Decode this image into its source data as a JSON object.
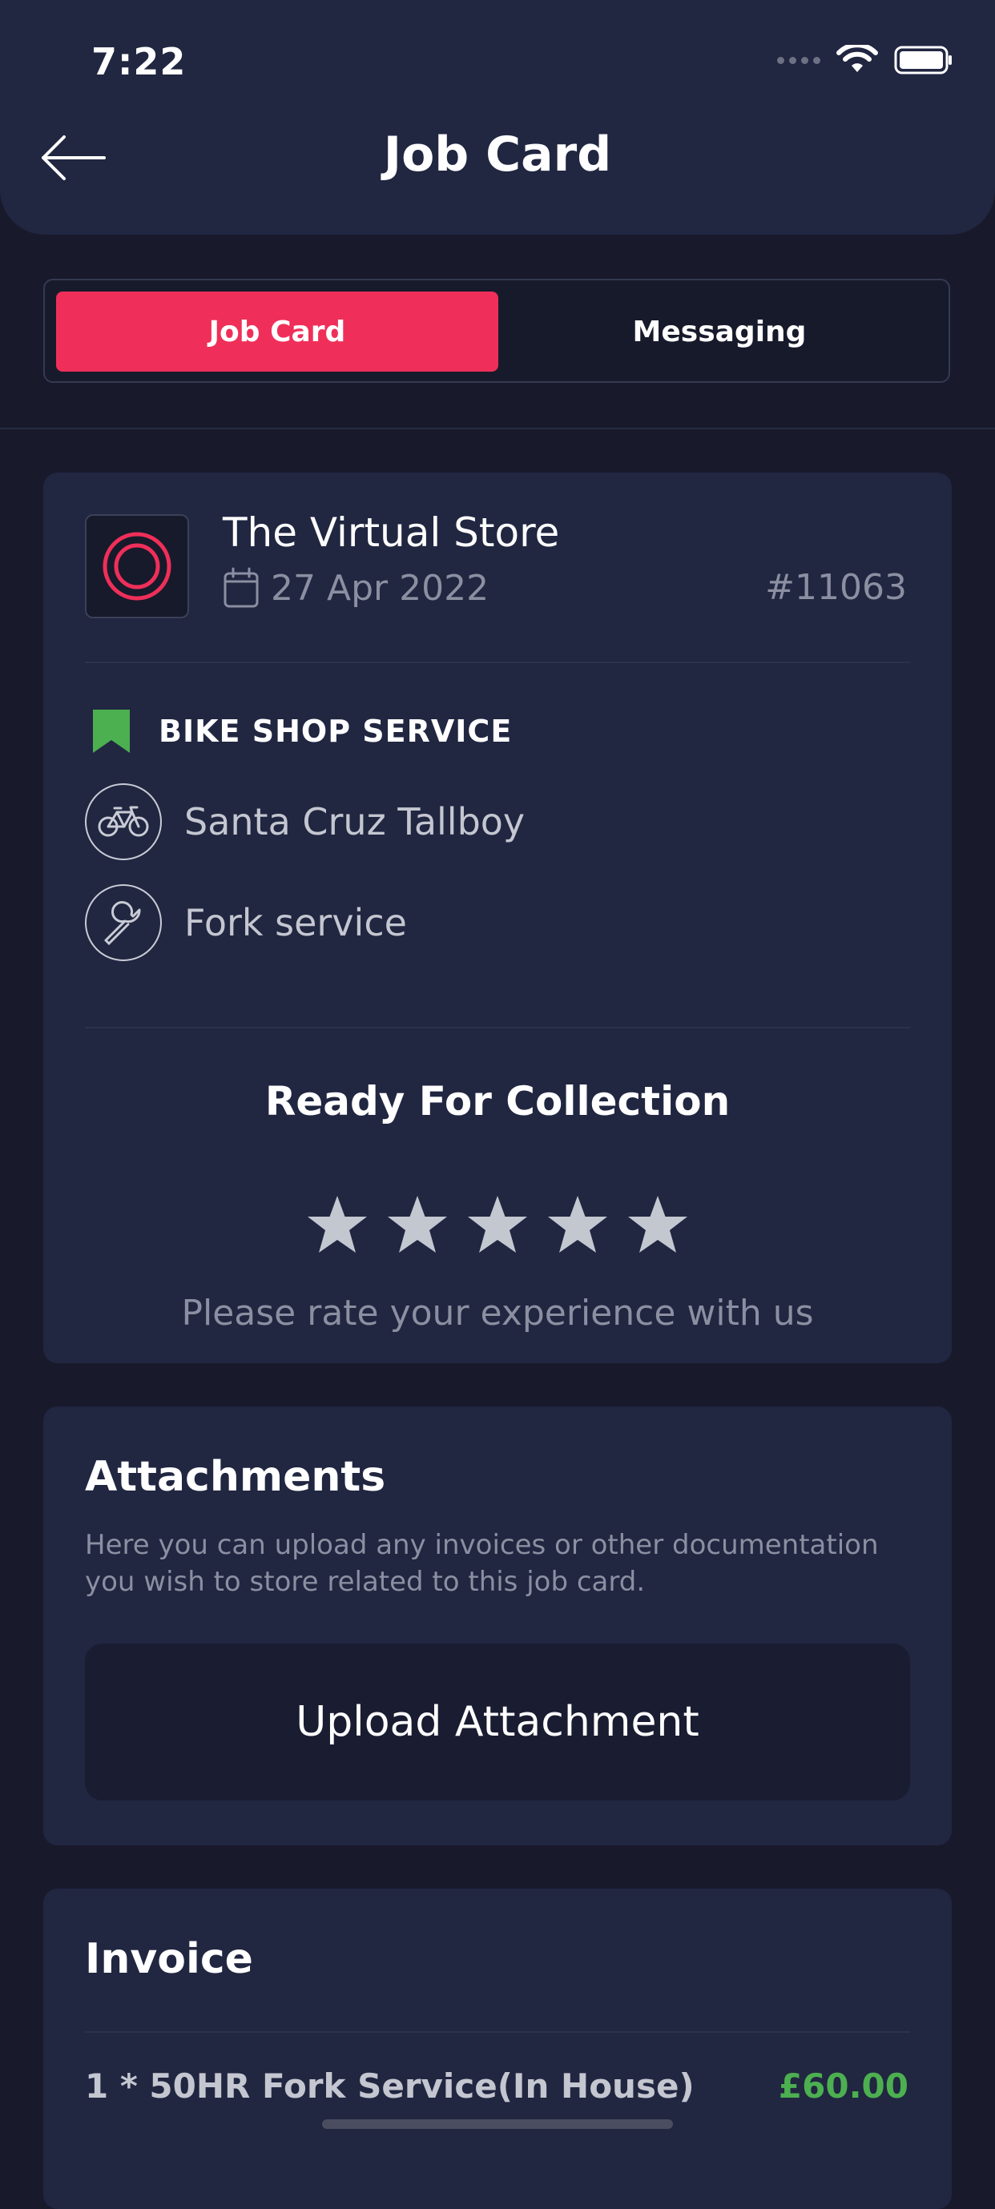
{
  "status_bar": {
    "time": "7:22"
  },
  "header": {
    "title": "Job Card"
  },
  "tabs": [
    {
      "label": "Job Card",
      "active": true
    },
    {
      "label": "Messaging",
      "active": false
    }
  ],
  "job": {
    "store_name": "The Virtual Store",
    "date": "27 Apr 2022",
    "number": "#11063",
    "service_type": "BIKE SHOP SERVICE",
    "items": [
      {
        "icon": "bicycle-icon",
        "label": "Santa Cruz Tallboy"
      },
      {
        "icon": "wrench-icon",
        "label": "Fork service"
      }
    ],
    "status": "Ready For Collection",
    "rating_prompt": "Please rate your experience with us",
    "rating": {
      "value": 0,
      "max": 5
    }
  },
  "attachments": {
    "title": "Attachments",
    "description": "Here you can upload any invoices or other documentation you wish to store related to this job card.",
    "upload_label": "Upload Attachment"
  },
  "invoice": {
    "title": "Invoice",
    "lines": [
      {
        "description": "1 * 50HR Fork Service(In House)",
        "price": "£60.00"
      }
    ]
  },
  "colors": {
    "background": "#181a2c",
    "card": "#212641",
    "accent": "#ef2f59",
    "service_badge": "#4caf50",
    "price": "#4caf50",
    "star": "#c3c7d0"
  }
}
